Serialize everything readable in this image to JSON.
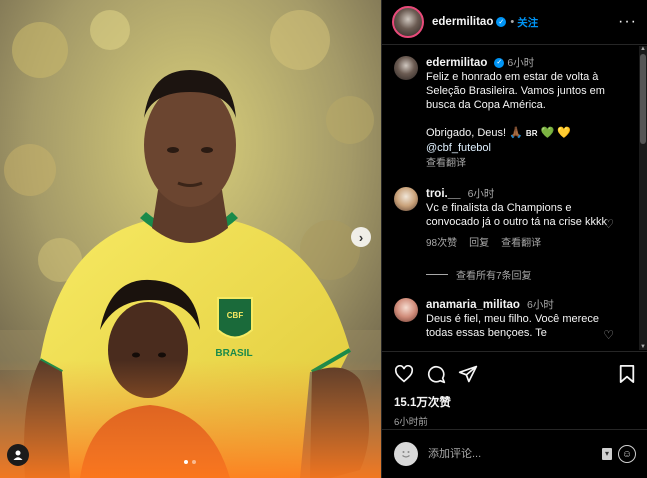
{
  "post": {
    "username": "edermilitao",
    "follow_label": "关注",
    "caption": {
      "time": "6小时",
      "text": "Feliz e honrado em estar de volta à Seleção Brasileira. Vamos juntos em busca da Copa América.\n\nObrigado, Deus! 🙏🏾",
      "flag": "BR",
      "hearts": "💚 💛",
      "mention": "@cbf_futebol",
      "translate": "查看翻译"
    },
    "jersey_text": "BRASIL",
    "crest_text": "CBF",
    "comments": [
      {
        "username": "troi.__",
        "time": "6小时",
        "text": "Vc e finalista da Champions e convocado já o outro tá na crise kkkk",
        "likes": "98次赞",
        "reply": "回复",
        "translate": "查看翻译",
        "view_replies": "查看所有7条回复"
      },
      {
        "username": "anamaria_militao",
        "time": "6小时",
        "text": "Deus é fiel, meu filho. Você merece todas essas bençoes. Te"
      }
    ],
    "likes_count": "15.1万次赞",
    "posted_ago": "6小时前",
    "comment_placeholder": "添加评论..."
  },
  "icons": {
    "like": "heart-icon",
    "comment": "comment-icon",
    "share": "share-icon",
    "save": "bookmark-icon",
    "more": "more-options-icon",
    "emoji": "emoji-icon",
    "tag": "user-tag-icon",
    "next": "chevron-right-icon"
  },
  "colors": {
    "background": "#000000",
    "accent_blue": "#0095f6",
    "text": "#f5f5f5",
    "muted": "#a8a8a8",
    "jersey_yellow": "#f2e04a",
    "jersey_green": "#1a8a4a"
  }
}
